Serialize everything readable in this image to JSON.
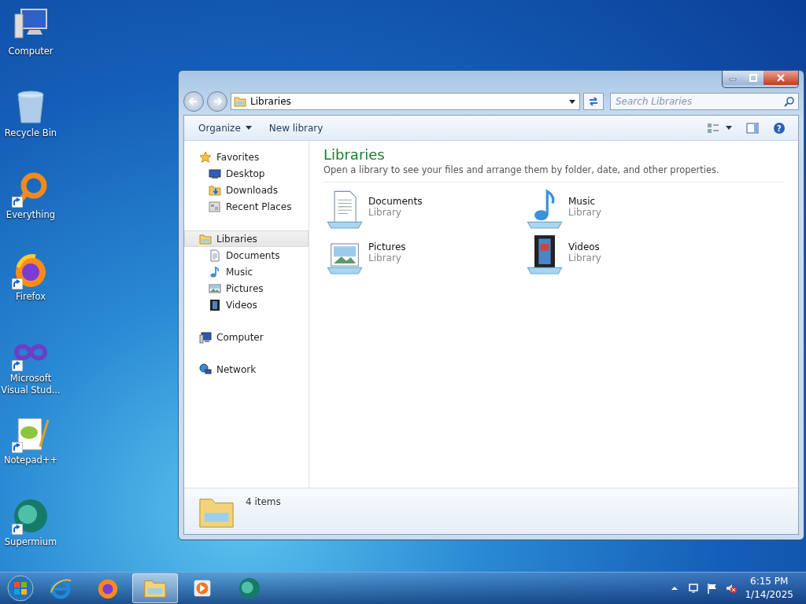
{
  "desktop_icons": [
    {
      "label": "Computer",
      "kind": "computer",
      "shortcut": false
    },
    {
      "label": "Recycle Bin",
      "kind": "bin",
      "shortcut": false
    },
    {
      "label": "Everything",
      "kind": "everything",
      "shortcut": true
    },
    {
      "label": "Firefox",
      "kind": "firefox",
      "shortcut": true
    },
    {
      "label": "Microsoft Visual Stud...",
      "kind": "vs",
      "shortcut": true
    },
    {
      "label": "Notepad++",
      "kind": "notepad",
      "shortcut": true
    },
    {
      "label": "Supermium",
      "kind": "supermium",
      "shortcut": true
    }
  ],
  "window": {
    "address": "Libraries",
    "search": {
      "placeholder": "Search Libraries"
    },
    "toolbar": [
      {
        "label": "Organize",
        "menu": true
      },
      {
        "label": "New library",
        "menu": false
      }
    ],
    "navigation": [
      {
        "label": "Favorites",
        "kind": "star",
        "selected": false,
        "children": [
          {
            "label": "Desktop",
            "kind": "desktop",
            "selected": false
          },
          {
            "label": "Downloads",
            "kind": "downloads",
            "selected": false
          },
          {
            "label": "Recent Places",
            "kind": "recent",
            "selected": false
          }
        ]
      },
      {
        "label": "Libraries",
        "kind": "library",
        "selected": true,
        "children": [
          {
            "label": "Documents",
            "kind": "document",
            "selected": false
          },
          {
            "label": "Music",
            "kind": "music",
            "selected": false
          },
          {
            "label": "Pictures",
            "kind": "picture",
            "selected": false
          },
          {
            "label": "Videos",
            "kind": "video",
            "selected": false
          }
        ]
      },
      {
        "label": "Computer",
        "kind": "computer",
        "selected": false
      },
      {
        "label": "Network",
        "kind": "network",
        "selected": false
      }
    ],
    "help": "?",
    "heading": "Libraries",
    "description": "Open a library to see your files and arrange them by folder, date, and other properties.",
    "items": [
      {
        "name": "Documents",
        "type": "Library",
        "kind": "document"
      },
      {
        "name": "Music",
        "type": "Library",
        "kind": "music"
      },
      {
        "name": "Pictures",
        "type": "Library",
        "kind": "picture"
      },
      {
        "name": "Videos",
        "type": "Library",
        "kind": "video"
      }
    ],
    "status": "4 items"
  },
  "taskbar": {
    "buttons": [
      {
        "kind": "ie",
        "selected": false
      },
      {
        "kind": "firefox",
        "selected": false
      },
      {
        "kind": "explorer",
        "selected": true
      },
      {
        "kind": "player",
        "selected": false
      },
      {
        "kind": "supermium",
        "selected": false
      }
    ],
    "time": "6:15 PM",
    "date": "1/14/2025"
  }
}
